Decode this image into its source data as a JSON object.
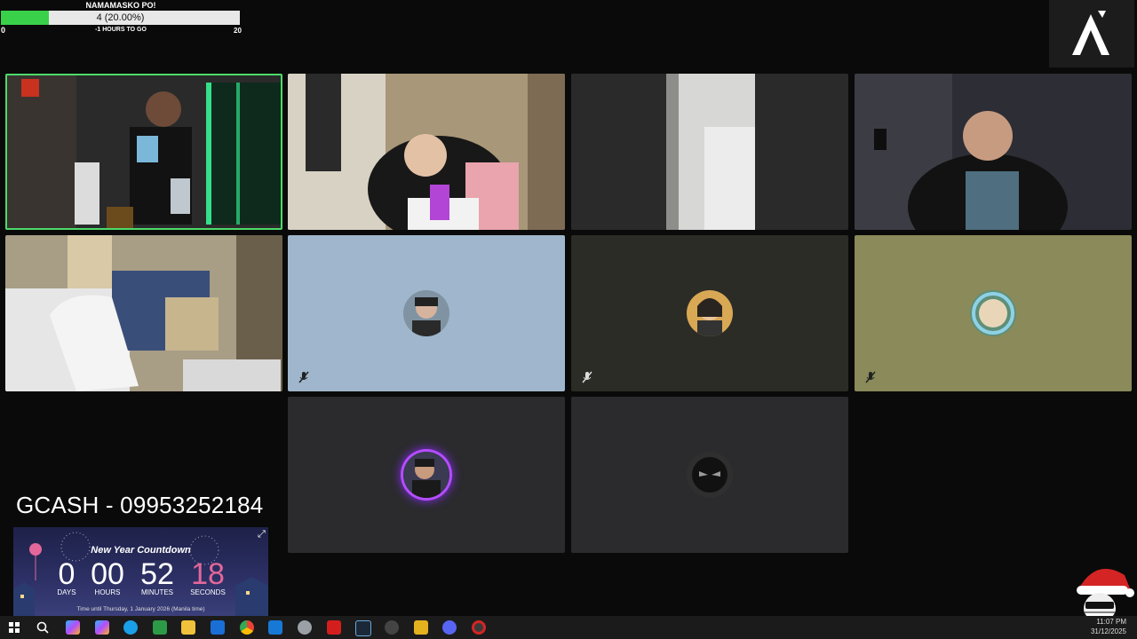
{
  "goal": {
    "title": "NAMAMASKO PO!",
    "status_text": "4 (20.00%)",
    "progress_fraction": 0.2,
    "min_label": "0",
    "max_label": "20",
    "subtitle": "-1 HOURS TO GO"
  },
  "donation": {
    "text": "GCASH - 09953252184"
  },
  "countdown": {
    "title": "New Year Countdown",
    "days": "0",
    "days_label": "DAYS",
    "hours": "00",
    "hours_label": "HOURS",
    "minutes": "52",
    "minutes_label": "MINUTES",
    "seconds": "18",
    "seconds_label": "SECONDS",
    "footer": "Time until Thursday, 1 January 2026 (Manila time)"
  },
  "taskbar": {
    "time": "11:07 PM",
    "date": "31/12/2025"
  },
  "colors": {
    "active_speaker": "#4cdb6a",
    "tile_blue": "#9fb6cc",
    "tile_dark_olive": "#2c2c26",
    "tile_olive": "#8a8a5a",
    "tile_gray": "#2b2b2e",
    "progress_fill": "#39d14a"
  }
}
